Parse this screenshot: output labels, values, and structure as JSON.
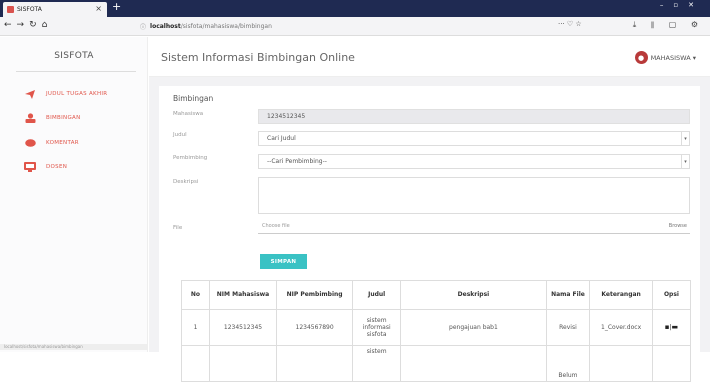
{
  "browser": {
    "tab_title": "SISFOTA",
    "url_host": "localhost",
    "url_path": "/sisfota/mahasiswa/bimbingan",
    "status_url": "localhost/sisfota/mahasiswa/bimbingan"
  },
  "sidebar": {
    "brand": "SISFOTA",
    "items": [
      {
        "label": "JUDUL TUGAS AKHIR",
        "icon": "send-icon"
      },
      {
        "label": "BIMBINGAN",
        "icon": "user-icon"
      },
      {
        "label": "KOMENTAR",
        "icon": "comment-icon"
      },
      {
        "label": "DOSEN",
        "icon": "people-icon"
      }
    ]
  },
  "header": {
    "title": "Sistem Informasi Bimbingan Online",
    "user": "MAHASISWA"
  },
  "form": {
    "title": "Bimbingan",
    "labels": {
      "mahasiswa": "Mahasiswa",
      "judul": "Judul",
      "pembimbing": "Pembimbing",
      "deskripsi": "Deskripsi",
      "file": "File"
    },
    "mahasiswa_value": "1234512345",
    "judul_value": "Cari Judul",
    "pembimbing_value": "--Cari Pembimbing--",
    "deskripsi_value": "",
    "file_placeholder": "Choose file",
    "browse_label": "Browse",
    "submit_label": "SIMPAN"
  },
  "table": {
    "headers": [
      "No",
      "NIM Mahasiswa",
      "NIP Pembimbing",
      "Judul",
      "Deskripsi",
      "Nama File",
      "Keterangan",
      "Opsi"
    ],
    "rows": [
      [
        "1",
        "1234512345",
        "1234567890",
        "sistem informasi sisfota",
        "pengajuan bab1",
        "Revisi",
        "1_Cover.docx",
        ""
      ],
      [
        "",
        "",
        "",
        "sistem",
        "",
        "Belum",
        "",
        ""
      ]
    ]
  }
}
